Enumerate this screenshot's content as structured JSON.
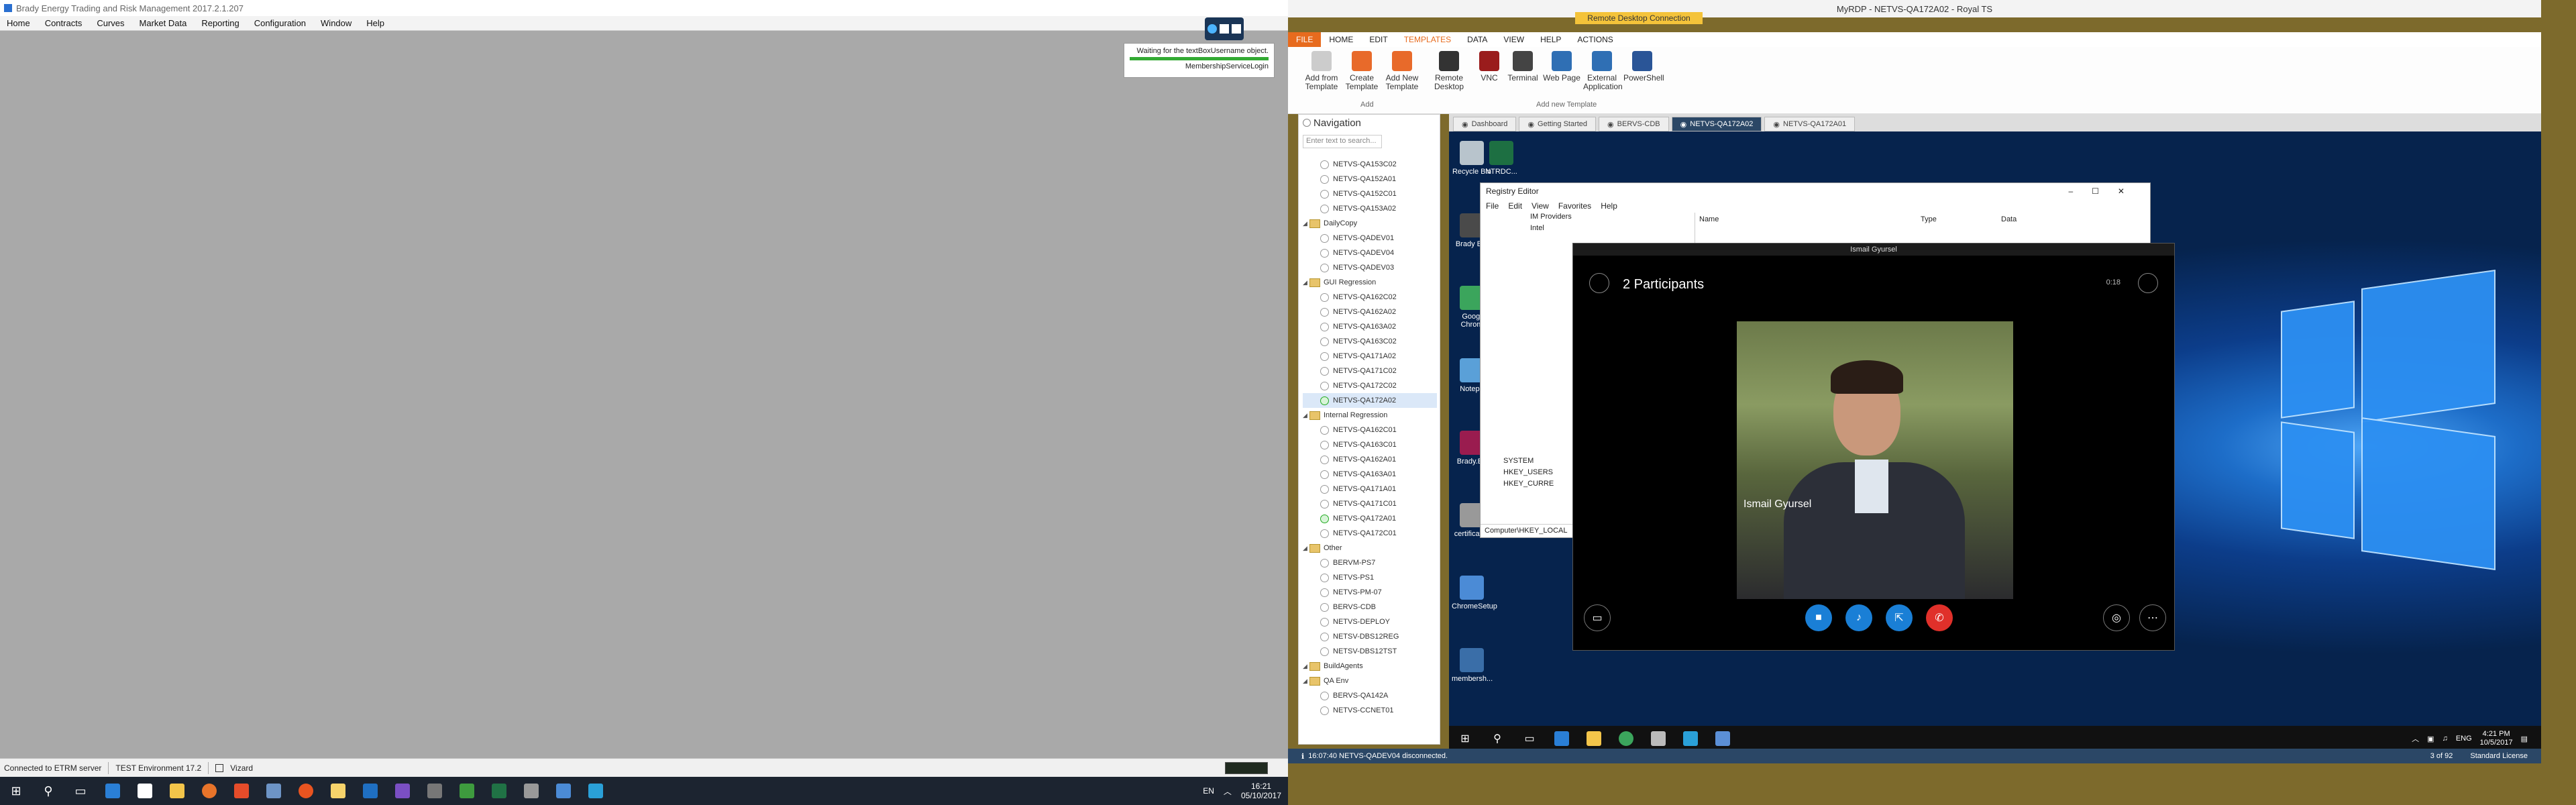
{
  "etrm": {
    "title": "Brady Energy Trading and Risk Management 2017.2.1.207",
    "menu": [
      "Home",
      "Contracts",
      "Curves",
      "Market Data",
      "Reporting",
      "Configuration",
      "Window",
      "Help"
    ],
    "toast_line1": "Waiting for the textBoxUsername object.",
    "toast_line2": "MembershipServiceLogin",
    "status_connected": "Connected to ETRM server",
    "status_env": "TEST Environment 17.2",
    "status_vizard": "Vizard"
  },
  "taskbar": {
    "lang": "EN",
    "time": "16:21",
    "date": "05/10/2017"
  },
  "royal": {
    "title": "MyRDP - NETVS-QA172A02 - Royal TS",
    "context_tab": "Remote Desktop Connection",
    "tabs": [
      "FILE",
      "HOME",
      "EDIT",
      "TEMPLATES",
      "DATA",
      "VIEW",
      "HELP",
      "ACTIONS"
    ],
    "ribbon": [
      {
        "label": "Add from Template",
        "color": "#cccccc"
      },
      {
        "label": "Create Template",
        "color": "#e86a2a"
      },
      {
        "label": "Add New Template",
        "color": "#e86a2a"
      },
      {
        "label": "Remote Desktop",
        "color": "#333333"
      },
      {
        "label": "VNC",
        "color": "#9a1c1c"
      },
      {
        "label": "Terminal",
        "color": "#444444"
      },
      {
        "label": "Web Page",
        "color": "#2f6fb4"
      },
      {
        "label": "External Application",
        "color": "#2f6fb4"
      },
      {
        "label": "PowerShell",
        "color": "#2a5597"
      }
    ],
    "group_add": "Add",
    "group_new_template": "Add new Template",
    "nav_title": "Navigation",
    "nav_search_placeholder": "Enter text to search...",
    "tree": [
      {
        "t": "i",
        "label": "NETVS-QA153C02"
      },
      {
        "t": "i",
        "label": "NETVS-QA152A01"
      },
      {
        "t": "i",
        "label": "NETVS-QA152C01"
      },
      {
        "t": "i",
        "label": "NETVS-QA153A02"
      },
      {
        "t": "f",
        "label": "DailyCopy"
      },
      {
        "t": "i",
        "label": "NETVS-QADEV01"
      },
      {
        "t": "i",
        "label": "NETVS-QADEV04"
      },
      {
        "t": "i",
        "label": "NETVS-QADEV03"
      },
      {
        "t": "f",
        "label": "GUI Regression"
      },
      {
        "t": "i",
        "label": "NETVS-QA162C02"
      },
      {
        "t": "i",
        "label": "NETVS-QA162A02"
      },
      {
        "t": "i",
        "label": "NETVS-QA163A02"
      },
      {
        "t": "i",
        "label": "NETVS-QA163C02"
      },
      {
        "t": "i",
        "label": "NETVS-QA171A02"
      },
      {
        "t": "i",
        "label": "NETVS-QA171C02"
      },
      {
        "t": "i",
        "label": "NETVS-QA172C02"
      },
      {
        "t": "s",
        "label": "NETVS-QA172A02"
      },
      {
        "t": "f",
        "label": "Internal Regression"
      },
      {
        "t": "i",
        "label": "NETVS-QA162C01"
      },
      {
        "t": "i",
        "label": "NETVS-QA163C01"
      },
      {
        "t": "i",
        "label": "NETVS-QA162A01"
      },
      {
        "t": "i",
        "label": "NETVS-QA163A01"
      },
      {
        "t": "i",
        "label": "NETVS-QA171A01"
      },
      {
        "t": "i",
        "label": "NETVS-QA171C01"
      },
      {
        "t": "o",
        "label": "NETVS-QA172A01"
      },
      {
        "t": "i",
        "label": "NETVS-QA172C01"
      },
      {
        "t": "f",
        "label": "Other"
      },
      {
        "t": "i",
        "label": "BERVM-PS7"
      },
      {
        "t": "i",
        "label": "NETVS-PS1"
      },
      {
        "t": "i",
        "label": "NETVS-PM-07"
      },
      {
        "t": "i",
        "label": "BERVS-CDB"
      },
      {
        "t": "i",
        "label": "NETVS-DEPLOY"
      },
      {
        "t": "i",
        "label": "NETSV-DBS12REG"
      },
      {
        "t": "i",
        "label": "NETSV-DBS12TST"
      },
      {
        "t": "f",
        "label": "BuildAgents"
      },
      {
        "t": "f",
        "label": "QA Env"
      },
      {
        "t": "i",
        "label": "BERVS-QA142A"
      },
      {
        "t": "i",
        "label": "NETVS-CCNET01"
      }
    ],
    "session_tabs": [
      "Dashboard",
      "Getting Started",
      "BERVS-CDB",
      "NETVS-QA172A02",
      "NETVS-QA172A01"
    ],
    "status_msg": "16:07:40 NETVS-QADEV04 disconnected.",
    "status_count": "3 of 92",
    "status_license": "Standard License"
  },
  "remote": {
    "desktop_icons": [
      "Recycle Bin",
      "NTRDC...",
      "Brady E...",
      "Googl Chrom",
      "Notepa",
      "Brady.En",
      "certificates",
      "ChromeSetup",
      "membersh..."
    ],
    "regedit_title": "Registry Editor",
    "regedit_menu": [
      "File",
      "Edit",
      "View",
      "Favorites",
      "Help"
    ],
    "reg_keys": [
      "IM Providers",
      "Intel",
      "SYSTEM",
      "HKEY_USERS",
      "HKEY_CURRE"
    ],
    "reg_cols": [
      "Name",
      "Type",
      "Data"
    ],
    "reg_path": "Computer\\HKEY_LOCAL",
    "skype_title": "Ismail Gyursel",
    "participants": "2 Participants",
    "caller_name": "Ismail Gyursel",
    "call_timer": "0:18",
    "lang": "ENG",
    "time": "4:21 PM",
    "date": "10/5/2017"
  }
}
